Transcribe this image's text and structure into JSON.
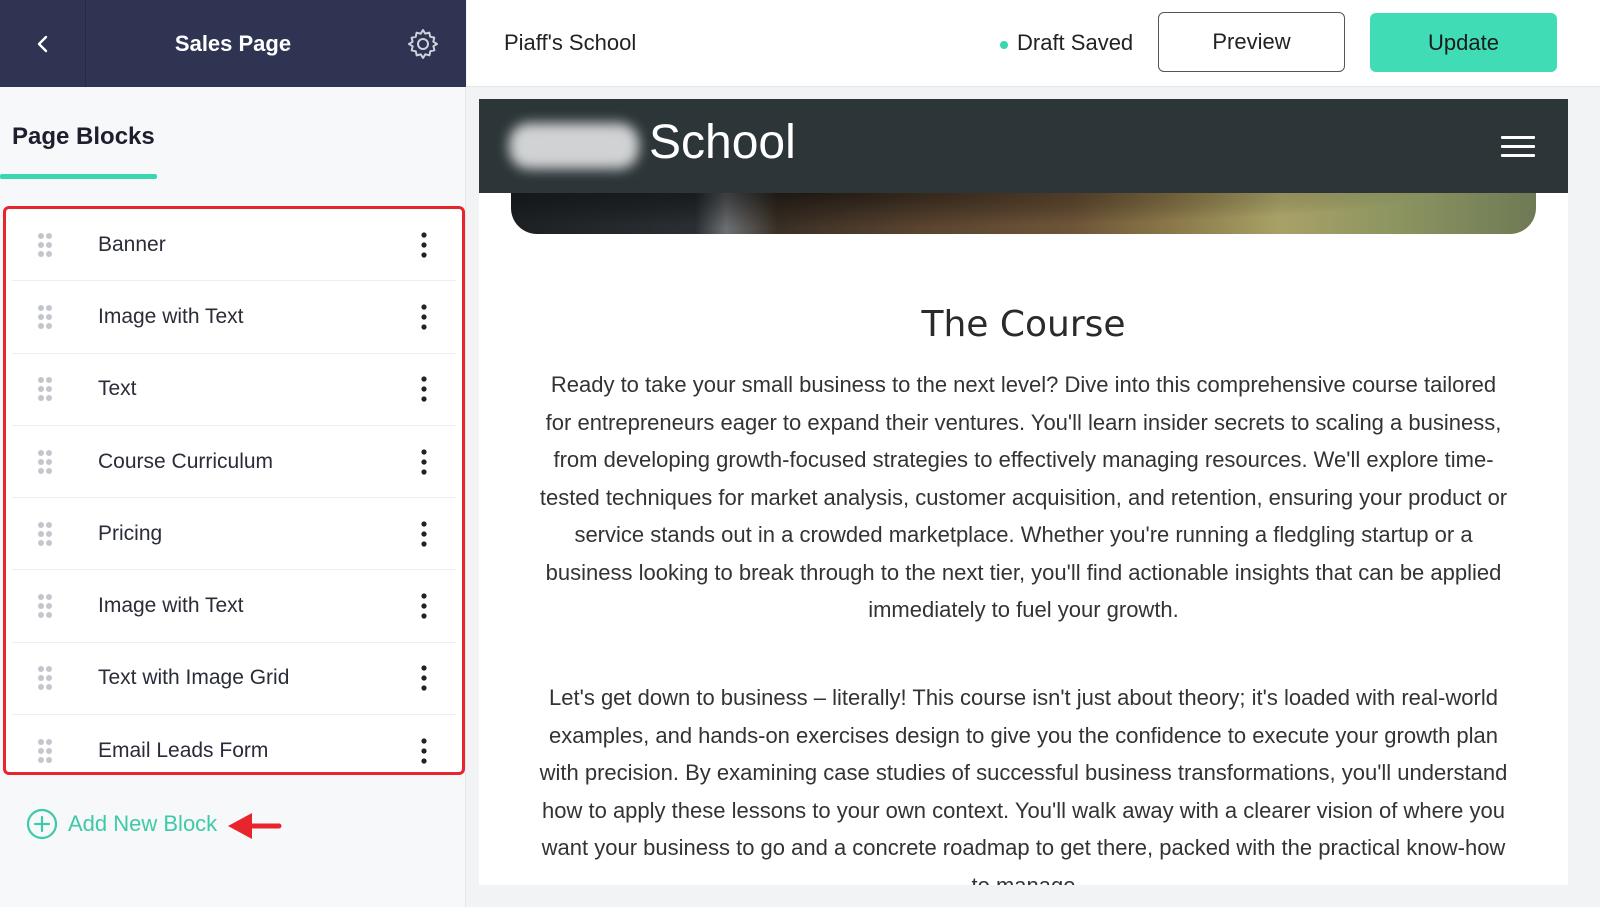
{
  "sidebar": {
    "title": "Sales Page",
    "tab_label": "Page Blocks",
    "blocks": [
      {
        "label": "Banner"
      },
      {
        "label": "Image with Text"
      },
      {
        "label": "Text"
      },
      {
        "label": "Course Curriculum"
      },
      {
        "label": "Pricing"
      },
      {
        "label": "Image with Text"
      },
      {
        "label": "Text with Image Grid"
      },
      {
        "label": "Email Leads Form"
      }
    ],
    "add_block_label": "Add New Block"
  },
  "topbar": {
    "school_name": "Piaff's School",
    "draft_status": "Draft Saved",
    "preview_label": "Preview",
    "update_label": "Update"
  },
  "preview": {
    "logo_text": "School",
    "section_title": "The Course",
    "paragraph_1": "Ready to take your small business to the next level? Dive into this comprehensive course tailored for entrepreneurs eager to expand their ventures. You'll learn insider secrets to scaling a business, from developing growth-focused strategies to effectively managing resources. We'll explore time-tested techniques for market analysis, customer acquisition, and retention, ensuring your product or service stands out in a crowded marketplace. Whether you're running a fledgling startup or a business looking to break through to the next tier, you'll find actionable insights that can be applied immediately to fuel your growth.",
    "paragraph_2": "Let's get down to business – literally! This course isn't just about theory; it's loaded with real-world examples, and hands-on exercises design to give you the confidence to execute your growth plan with precision. By examining case studies of successful business transformations, you'll understand how to apply these lessons to your own context. You'll walk away with a clearer vision of where you want your business to go and a concrete roadmap to get there, packed with the practical know-how to manage"
  },
  "colors": {
    "sidebar_header": "#2f3452",
    "accent": "#39d6b0",
    "update_button": "#3fdcb5",
    "highlight_border": "#e8242d",
    "site_header": "#2c3538"
  },
  "icons": {
    "back": "chevron-left-icon",
    "settings": "gear-icon",
    "drag": "drag-handle-icon",
    "more": "kebab-menu-icon",
    "add": "plus-circle-icon",
    "menu": "hamburger-icon"
  }
}
